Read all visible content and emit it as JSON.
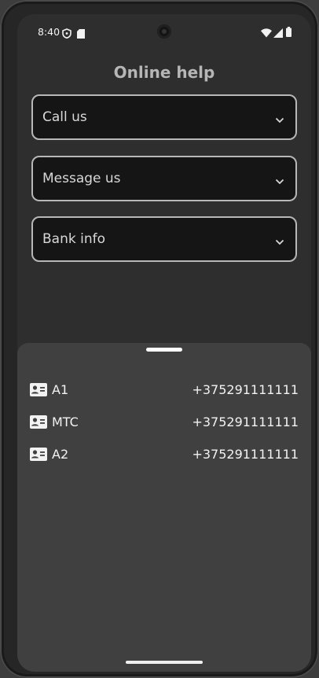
{
  "status_bar": {
    "time": "8:40",
    "icons": [
      "shield-icon",
      "sd-card-icon",
      "wifi-icon",
      "signal-icon",
      "battery-icon"
    ]
  },
  "page": {
    "title": "Online help"
  },
  "accordions": [
    {
      "label": "Call us",
      "icon": "chevron-down-icon"
    },
    {
      "label": "Message us",
      "icon": "chevron-down-icon"
    },
    {
      "label": "Bank info",
      "icon": "chevron-down-icon"
    }
  ],
  "sheet": {
    "contacts": [
      {
        "name": "A1",
        "phone": "+375291111111",
        "icon": "contact-card-icon"
      },
      {
        "name": "MTC",
        "phone": "+375291111111",
        "icon": "contact-card-icon"
      },
      {
        "name": "A2",
        "phone": "+375291111111",
        "icon": "contact-card-icon"
      }
    ]
  },
  "colors": {
    "background": "#2e2e2e",
    "sheet": "#404040",
    "field_border": "#b7b7b7",
    "field_fill": "#151515",
    "title": "#b6b6b6",
    "text": "#f2f2f2"
  }
}
